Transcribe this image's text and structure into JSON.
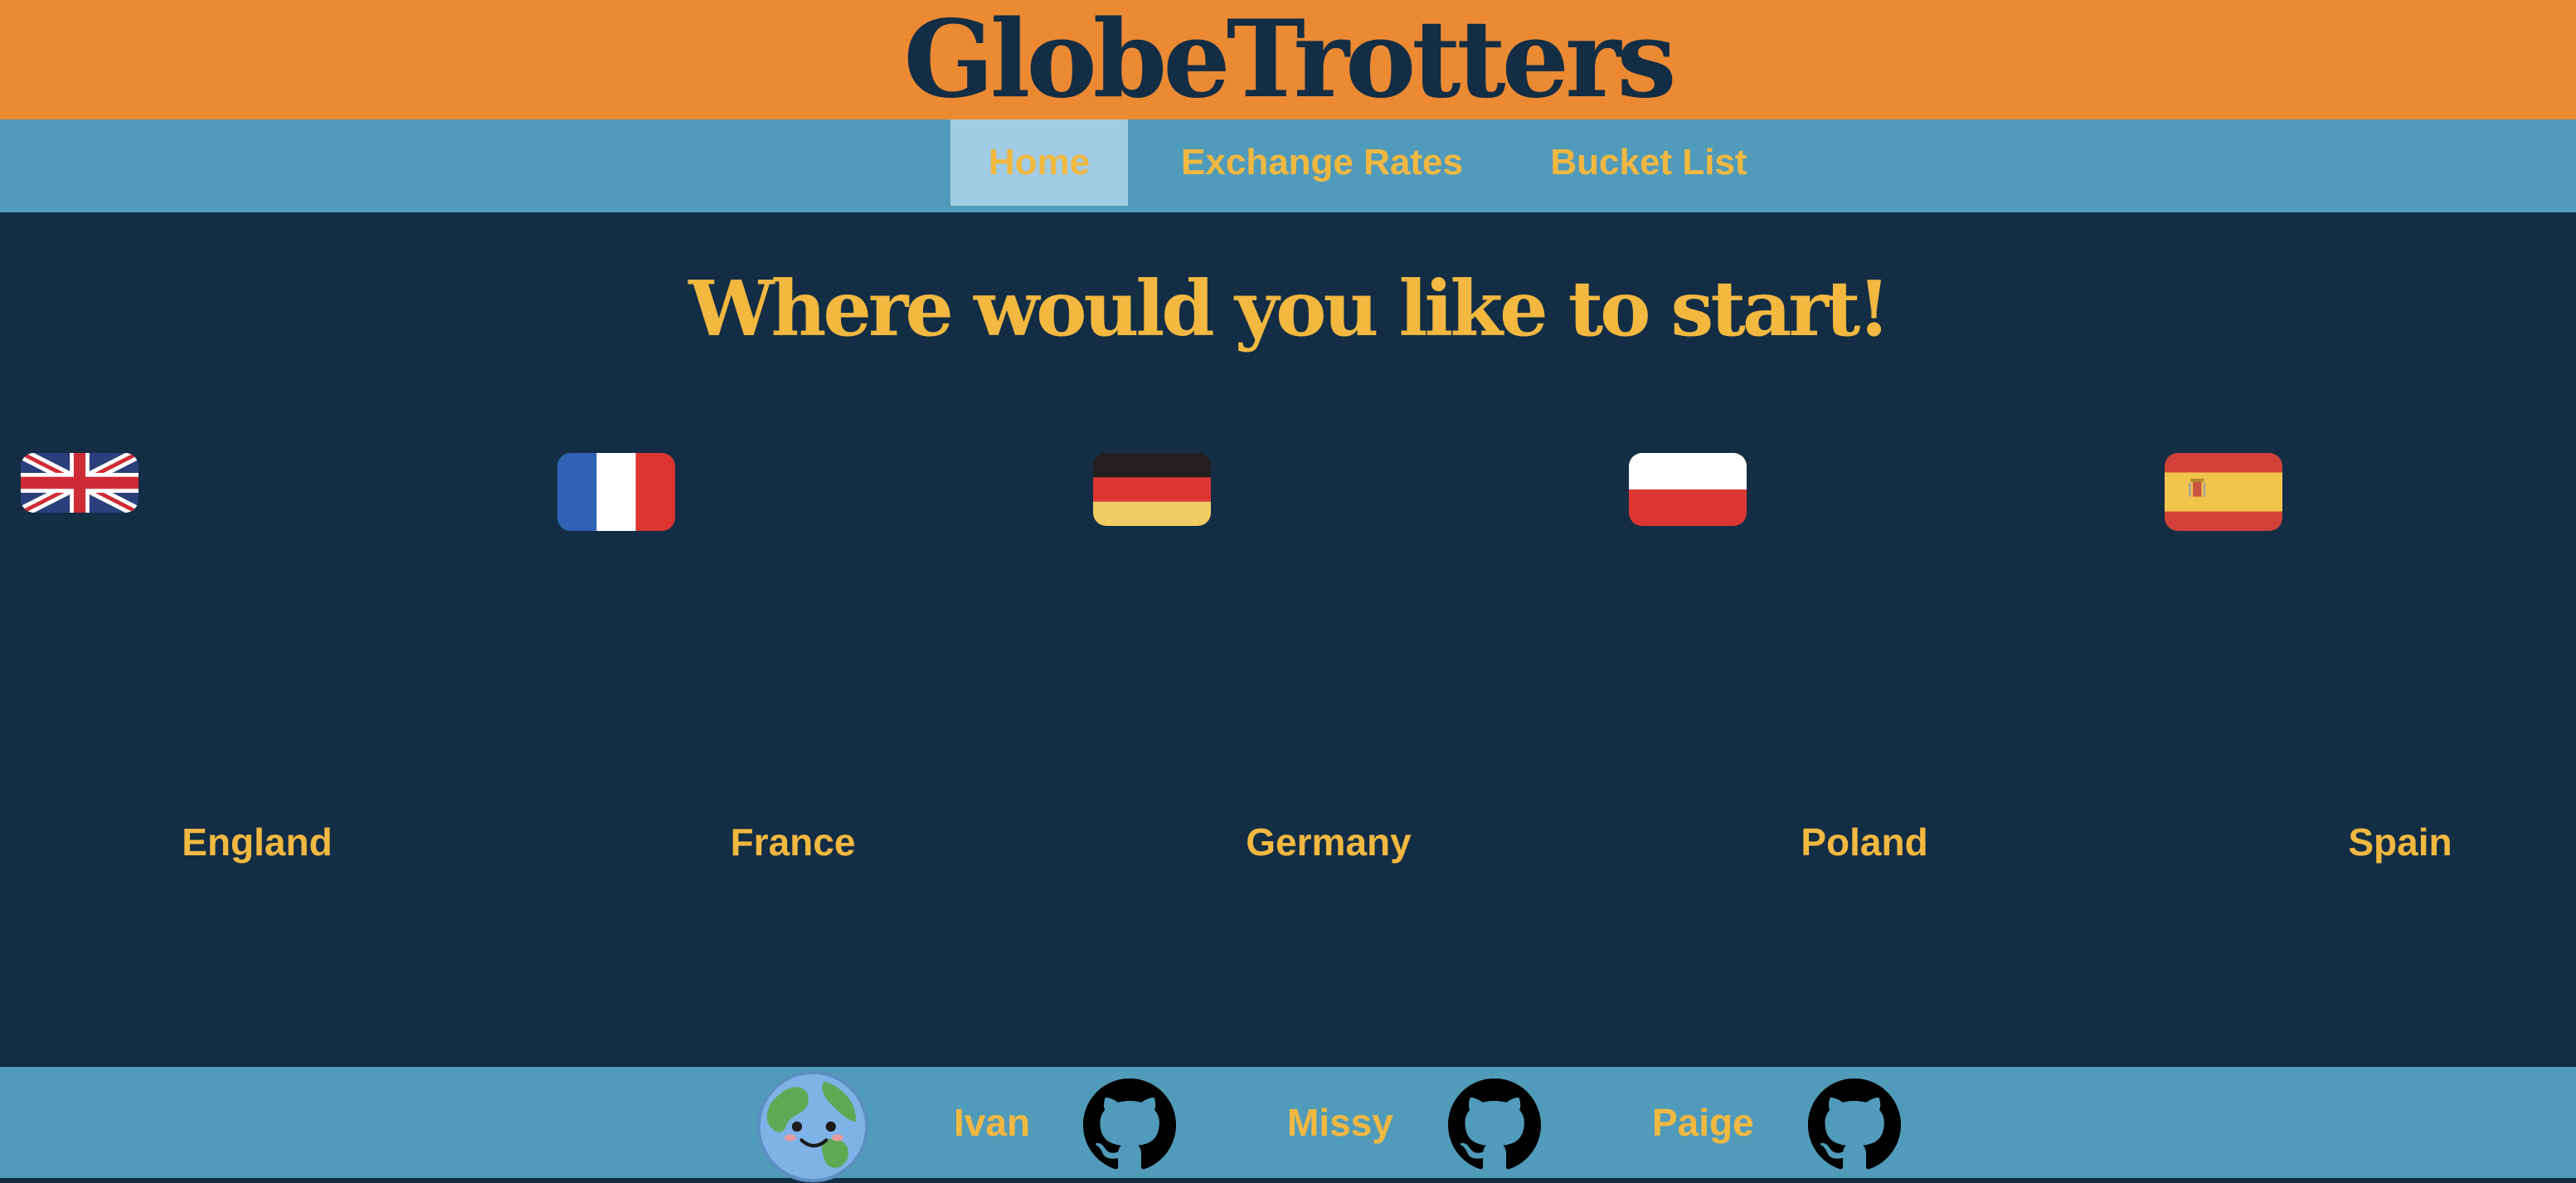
{
  "header": {
    "title": "GlobeTrotters"
  },
  "nav": {
    "items": [
      {
        "label": "Home",
        "active": true
      },
      {
        "label": "Exchange Rates",
        "active": false
      },
      {
        "label": "Bucket List",
        "active": false
      }
    ]
  },
  "main": {
    "heading": "Where would you like to start!",
    "countries": [
      {
        "name": "England",
        "flag_icon": "uk-flag-icon"
      },
      {
        "name": "France",
        "flag_icon": "france-flag-icon"
      },
      {
        "name": "Germany",
        "flag_icon": "germany-flag-icon"
      },
      {
        "name": "Poland",
        "flag_icon": "poland-flag-icon"
      },
      {
        "name": "Spain",
        "flag_icon": "spain-flag-icon"
      }
    ]
  },
  "footer": {
    "logo_icon": "globe-face-icon",
    "members": [
      {
        "name": "Ivan",
        "icon": "github-icon"
      },
      {
        "name": "Missy",
        "icon": "github-icon"
      },
      {
        "name": "Paige",
        "icon": "github-icon"
      }
    ]
  },
  "colors": {
    "header_bg": "#eb8a33",
    "nav_bg": "#519bba",
    "nav_active_bg": "#a2cce4",
    "main_bg": "#132d45",
    "accent_text": "#f2b840"
  }
}
